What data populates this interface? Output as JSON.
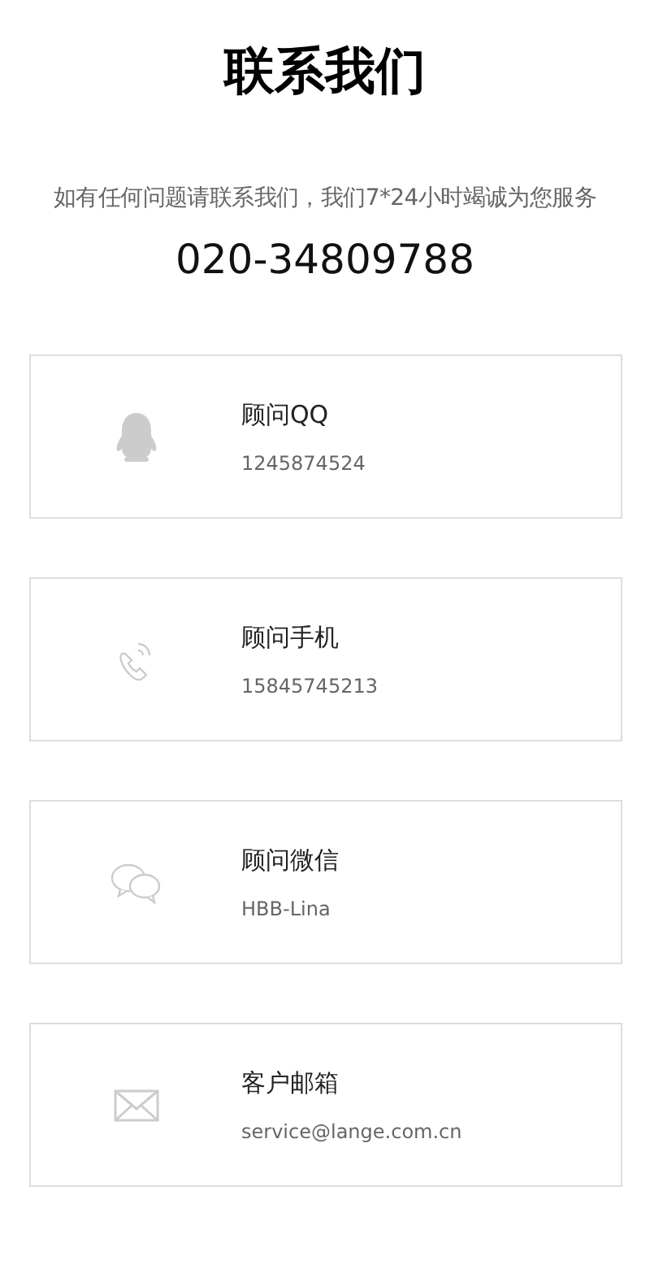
{
  "title": "联系我们",
  "intro": "如有任何问题请联系我们，我们7*24小时竭诚为您服务",
  "hotline": "020-34809788",
  "contacts": [
    {
      "kind": "qq",
      "label": "顾问QQ",
      "value": "1245874524"
    },
    {
      "kind": "phone",
      "label": "顾问手机",
      "value": "15845745213"
    },
    {
      "kind": "wechat",
      "label": "顾问微信",
      "value": "HBB-Lina"
    },
    {
      "kind": "mail",
      "label": "客户邮箱",
      "value": "service@lange.com.cn"
    }
  ]
}
